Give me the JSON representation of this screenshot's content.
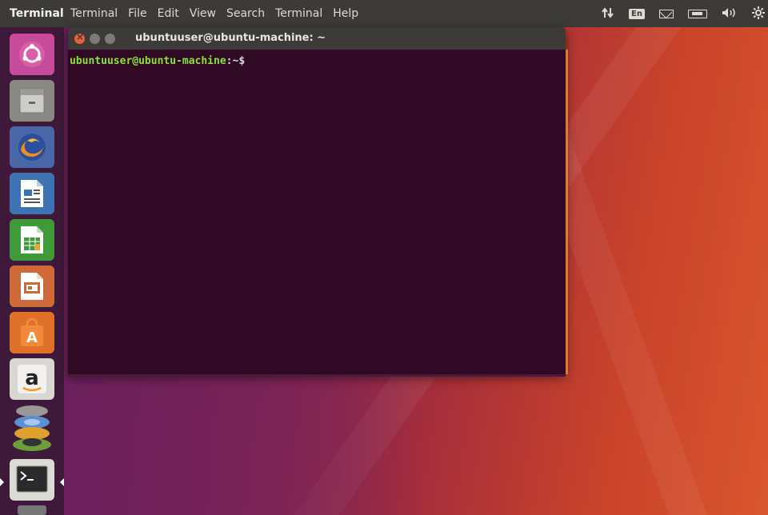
{
  "top_panel": {
    "app_name": "Terminal",
    "menu": [
      "Terminal",
      "File",
      "Edit",
      "View",
      "Search",
      "Terminal",
      "Help"
    ],
    "indicators": {
      "network": "network-updown-icon",
      "keyboard": "En",
      "mail": "mail-icon",
      "battery": "battery-icon",
      "volume": "volume-icon",
      "settings": "settings-gear-icon"
    }
  },
  "launcher": {
    "items": [
      {
        "name": "dash-icon"
      },
      {
        "name": "files-icon"
      },
      {
        "name": "firefox-icon"
      },
      {
        "name": "libreoffice-writer-icon"
      },
      {
        "name": "libreoffice-calc-icon"
      },
      {
        "name": "libreoffice-impress-icon"
      },
      {
        "name": "software-center-icon"
      },
      {
        "name": "amazon-icon",
        "glyph": "a"
      },
      {
        "name": "system-settings-icon"
      },
      {
        "name": "terminal-launcher-icon"
      }
    ]
  },
  "terminal": {
    "title": "ubuntuuser@ubuntu-machine: ~",
    "prompt_user": "ubuntuuser@ubuntu-machine",
    "prompt_path": ":~$"
  },
  "colors": {
    "panel": "#3c3b37",
    "terminal_bg": "#300a24",
    "prompt_green": "#8ae234",
    "close_button": "#e9603c"
  }
}
